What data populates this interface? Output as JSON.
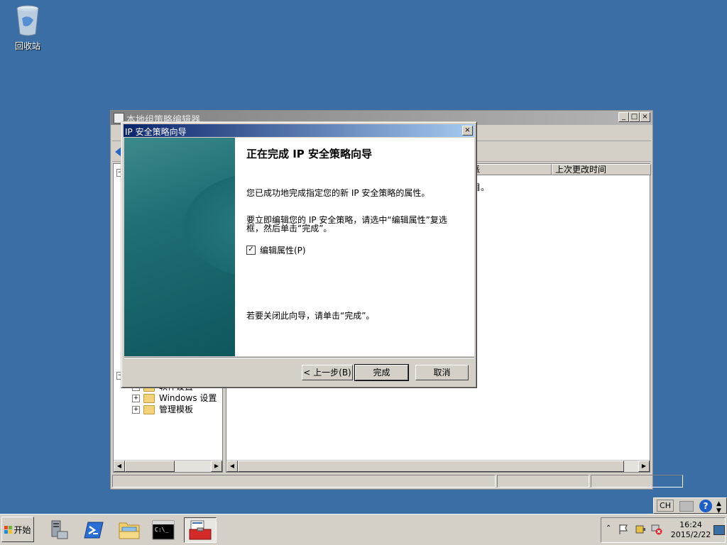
{
  "desktop": {
    "recycle_bin_label": "回收站"
  },
  "gpe_window": {
    "title": "本地组策略编辑器",
    "min_glyph": "_",
    "max_glyph": "□",
    "close_glyph": "×",
    "columns": [
      "派",
      "上次更改时间"
    ],
    "right_text": "目。",
    "tree_items": [
      "软件设置",
      "Windows 设置",
      "管理模板"
    ]
  },
  "wizard": {
    "title": "IP 安全策略向导",
    "heading": "正在完成 IP 安全策略向导",
    "para1": "您已成功地完成指定您的新 IP 安全策略的属性。",
    "para2": "要立即编辑您的 IP 安全策略，请选中“编辑属性”复选框，然后单击“完成”。",
    "checkbox_label": "编辑属性(P)",
    "checkbox_checked": true,
    "para3": "若要关闭此向导，请单击“完成”。",
    "back_label": "< 上一步(B)",
    "finish_label": "完成",
    "cancel_label": "取消"
  },
  "langbar": {
    "lang": "CH",
    "help": "?"
  },
  "taskbar": {
    "start_label": "开始",
    "time": "16:24",
    "date": "2015/2/22"
  }
}
